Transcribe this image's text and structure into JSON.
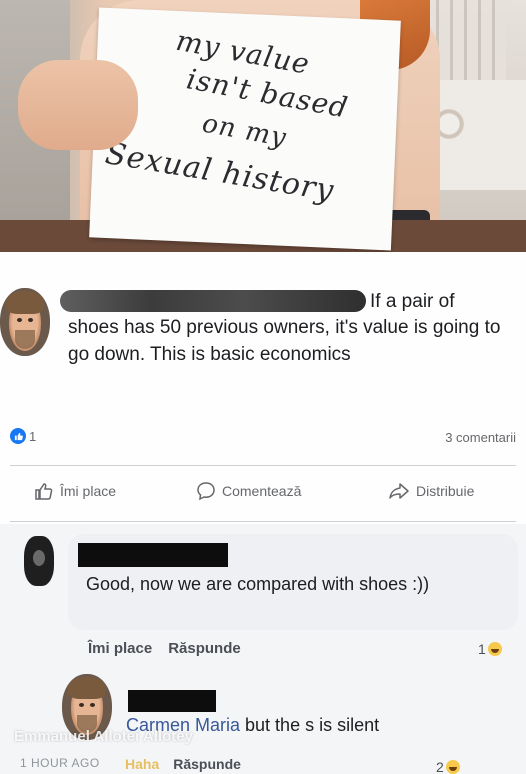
{
  "photo": {
    "sign_lines": [
      "my value",
      "isn't based",
      "on my",
      "Sexual history"
    ]
  },
  "post": {
    "text_first_line": "If a pair of",
    "text_body": "shoes has 50 previous owners, it's value is going to go down. This is basic economics",
    "reaction_count": "1",
    "comment_count": "3 comentarii",
    "actions": {
      "like": "Îmi place",
      "comment": "Comentează",
      "share": "Distribuie"
    }
  },
  "comment": {
    "text": "Good, now we are compared with shoes :))",
    "like": "Îmi place",
    "reply": "Răspunde",
    "reaction_count": "1"
  },
  "reply": {
    "mention": "Carmen Maria",
    "text": " but the s is silent",
    "watermark": "Emmanuel Allotei Allotey",
    "time": "1 HOUR AGO",
    "haha": "Haha",
    "reply_label": "Răspunde",
    "reaction_count": "2"
  },
  "colors": {
    "facebook_blue": "#1877f2",
    "mention_blue": "#385898"
  }
}
